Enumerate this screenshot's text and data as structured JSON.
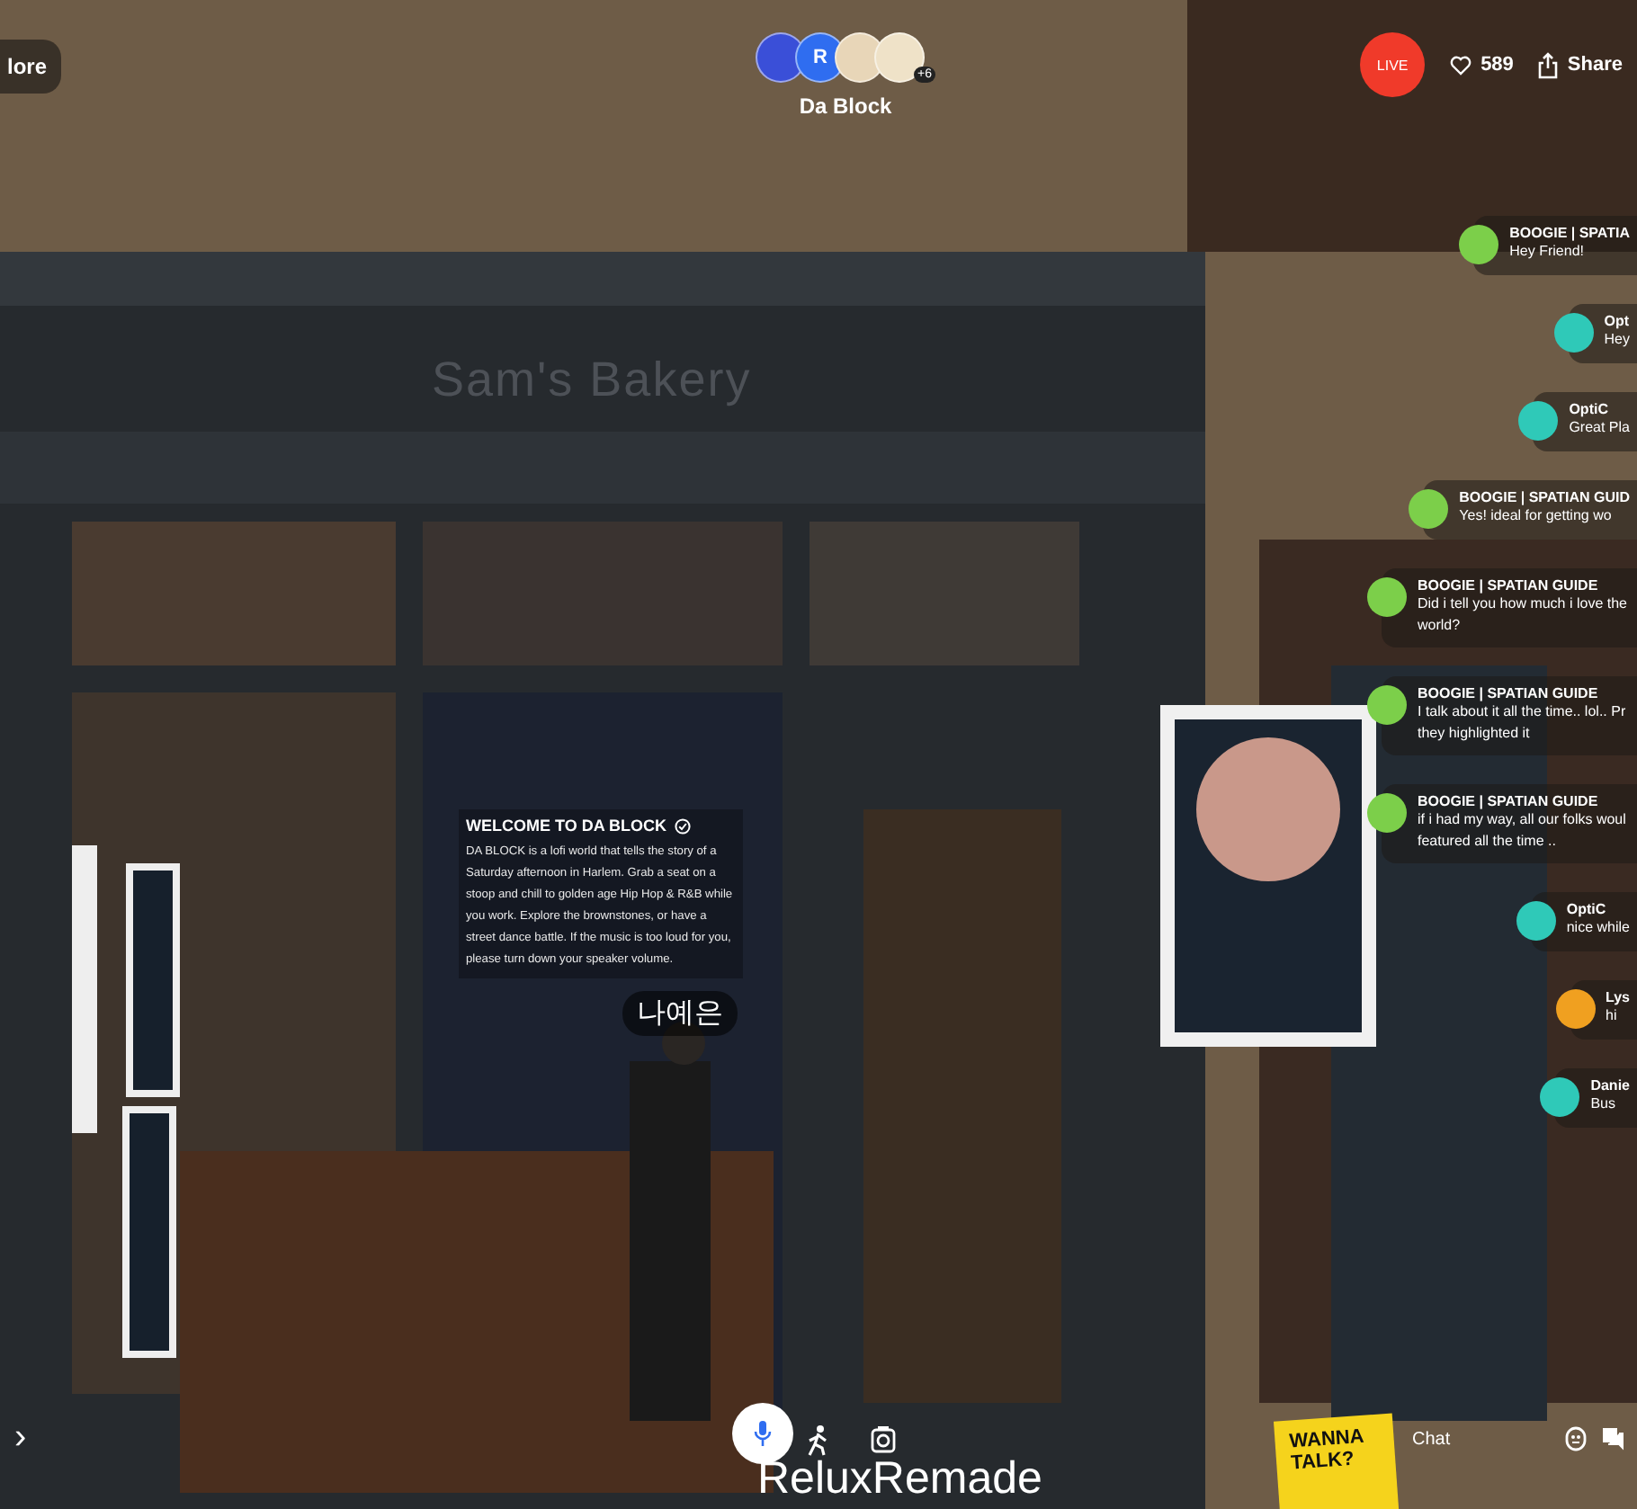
{
  "top_bar": {
    "more_button": "lore",
    "room": {
      "avatars": [
        {
          "color": "#3a4fd8"
        },
        {
          "initial": "R",
          "color": "#2f6df0"
        },
        {
          "color": "#e8d6b8"
        },
        {
          "color": "#efe2c8"
        }
      ],
      "extra_count": "+6",
      "title": "Da Block"
    },
    "live_badge": "LIVE",
    "likes": "589",
    "share_button": "Share"
  },
  "scene": {
    "shop_sign": "Sam's Bakery",
    "welcome_panel": {
      "title": "WELCOME TO DA BLOCK",
      "text": "DA BLOCK is a lofi world that tells the story of a Saturday afternoon in Harlem. Grab a seat on a stoop and chill to golden age Hip Hop & R&B while you work. Explore the brownstones, or have a street dance battle. If the music is too loud for you, please turn down your speaker volume."
    },
    "name_tags": [
      "나예은",
      "ReluxRemade"
    ],
    "sign": "WANNA TALK?"
  },
  "chat": {
    "messages": [
      {
        "author": "BOOGIE | SPATIA",
        "text": "Hey Friend!",
        "color": "#7ccf4a"
      },
      {
        "author": "Opt",
        "text": "Hey",
        "color": "#2fc9b8"
      },
      {
        "author": "OptiC",
        "text": "Great Pla",
        "color": "#2fc9b8"
      },
      {
        "author": "BOOGIE | SPATIAN GUID",
        "text": "Yes! ideal for getting wo",
        "color": "#7ccf4a"
      },
      {
        "author": "BOOGIE | SPATIAN GUIDE",
        "text": "Did i tell you how much i love the world?",
        "color": "#7ccf4a"
      },
      {
        "author": "BOOGIE | SPATIAN GUIDE",
        "text": "I talk about it all the time.. lol.. Pr they highlighted it",
        "color": "#7ccf4a"
      },
      {
        "author": "BOOGIE | SPATIAN GUIDE",
        "text": "if i had my way, all our folks woul featured all the time ..",
        "color": "#7ccf4a"
      },
      {
        "author": "OptiC",
        "text": "nice while",
        "color": "#2fc9b8"
      },
      {
        "author": "Lys",
        "text": "hi",
        "color": "#f0a020"
      },
      {
        "author": "Danie",
        "text": "Bus",
        "color": "#2fc9b8"
      }
    ],
    "label": "Chat"
  },
  "bottom_bar": {
    "expand": "›"
  }
}
